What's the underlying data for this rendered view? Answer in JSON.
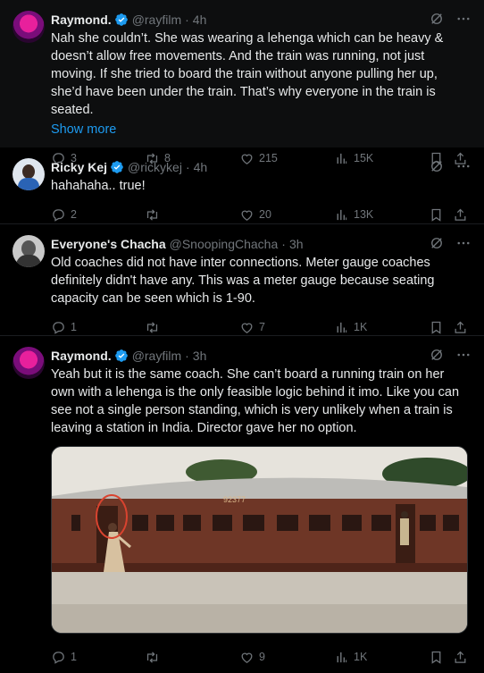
{
  "tweets": [
    {
      "name": "Raymond.",
      "handle": "@rayfilm",
      "time": "4h",
      "text": "Nah she couldn’t. She was wearing a lehenga which can be heavy & doesn’t allow free movements. And the train was running, not just moving. If she tried to board the train without anyone pulling her up, she’d have been under the train. That’s why everyone in the train is seated.",
      "show_more": "Show more",
      "replies": "3",
      "reposts": "8",
      "likes": "215",
      "views": "15K"
    },
    {
      "name": "Ricky Kej",
      "handle": "@rickykej",
      "time": "4h",
      "text": "hahahaha.. true!",
      "replies": "2",
      "reposts": "",
      "likes": "20",
      "views": "13K"
    },
    {
      "name": "Everyone's Chacha",
      "handle": "@SnoopingChacha",
      "time": "3h",
      "text": "Old coaches did not have inter connections. Meter gauge coaches definitely didn't have any. This was a meter gauge because seating capacity can be seen which is 1-90.",
      "replies": "1",
      "reposts": "",
      "likes": "7",
      "views": "1K"
    },
    {
      "name": "Raymond.",
      "handle": "@rayfilm",
      "time": "3h",
      "text": "Yeah but it is the same coach. She can’t board a running train on her own with a lehenga is the only feasible logic behind it imo. Like you can see not a single person standing, which is very unlikely when a train is leaving a station in India. Director gave her no option.",
      "media_coach_number": "92377",
      "replies": "1",
      "reposts": "",
      "likes": "9",
      "views": "1K"
    }
  ],
  "sep": "·",
  "colors": {
    "verified": "#1d9bf0",
    "link": "#1d9bf0",
    "muted": "#71767b"
  },
  "icons": [
    "verified-badge-icon",
    "grok-icon",
    "more-icon",
    "reply-icon",
    "repost-icon",
    "like-icon",
    "views-icon",
    "bookmark-icon",
    "share-icon"
  ]
}
